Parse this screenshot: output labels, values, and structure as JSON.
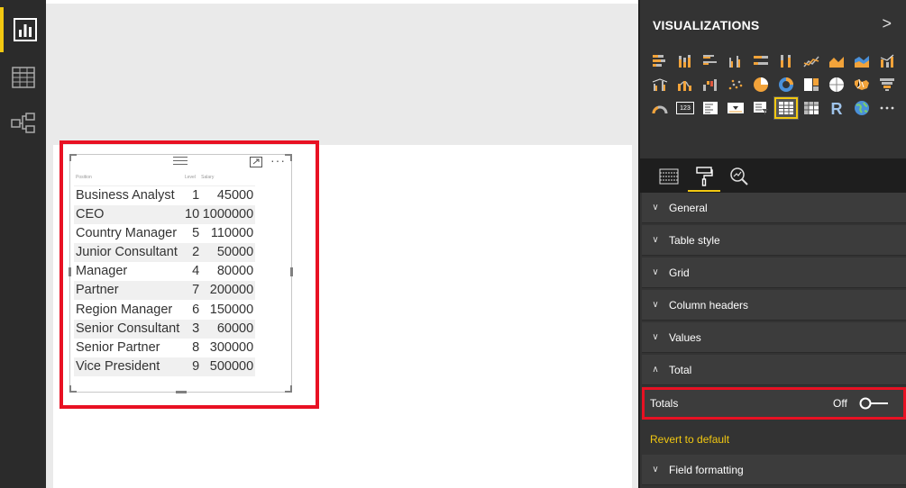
{
  "rail": {
    "items": [
      {
        "name": "report-view",
        "icon": "bar-chart-icon",
        "active": true
      },
      {
        "name": "data-view",
        "icon": "table-grid-icon",
        "active": false
      },
      {
        "name": "relationships-view",
        "icon": "relationship-icon",
        "active": false
      }
    ]
  },
  "visual": {
    "columns": [
      "Position",
      "Level",
      "Salary"
    ],
    "rows": [
      [
        "Business Analyst",
        "1",
        "45000"
      ],
      [
        "CEO",
        "10",
        "1000000"
      ],
      [
        "Country Manager",
        "5",
        "110000"
      ],
      [
        "Junior Consultant",
        "2",
        "50000"
      ],
      [
        "Manager",
        "4",
        "80000"
      ],
      [
        "Partner",
        "7",
        "200000"
      ],
      [
        "Region Manager",
        "6",
        "150000"
      ],
      [
        "Senior Consultant",
        "3",
        "60000"
      ],
      [
        "Senior Partner",
        "8",
        "300000"
      ],
      [
        "Vice President",
        "9",
        "500000"
      ]
    ],
    "more_label": "···"
  },
  "pane": {
    "title": "VISUALIZATIONS",
    "collapse_icon": ">",
    "viz_icons": [
      "stacked-bar-icon",
      "stacked-column-icon",
      "clustered-bar-icon",
      "clustered-column-icon",
      "100-bar-icon",
      "100-column-icon",
      "line-chart-icon",
      "area-chart-icon",
      "stacked-area-icon",
      "line-column-icon",
      "line-clustered-icon",
      "ribbon-icon",
      "waterfall-icon",
      "scatter-icon",
      "pie-icon",
      "donut-icon",
      "treemap-icon",
      "map-icon",
      "filled-map-icon",
      "funnel-icon",
      "gauge-icon",
      "card-icon",
      "multi-row-card-icon",
      "kpi-icon",
      "slicer-icon",
      "table-icon",
      "matrix-icon",
      "r-visual-icon",
      "globe-icon",
      "more-icon"
    ],
    "selected_viz": "table-icon",
    "tabs": [
      "fields-icon",
      "format-paint-icon",
      "analytics-icon"
    ],
    "sections": {
      "general": "General",
      "table_style": "Table style",
      "grid": "Grid",
      "column_headers": "Column headers",
      "values": "Values",
      "total": "Total",
      "field_formatting": "Field formatting"
    },
    "totals": {
      "label": "Totals",
      "state": "Off"
    },
    "revert": "Revert to default"
  },
  "colors": {
    "accent": "#f2c811",
    "highlight": "#e81123"
  }
}
